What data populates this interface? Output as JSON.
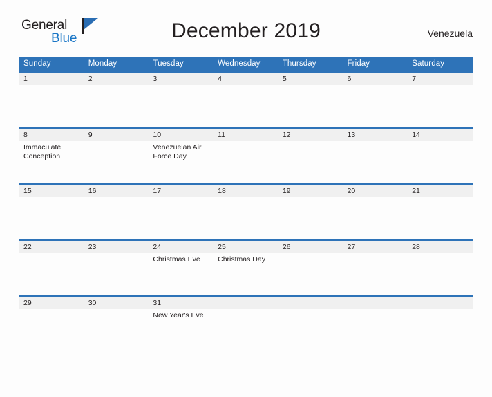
{
  "logo": {
    "word_one": "General",
    "word_two": "Blue",
    "flag_color": "#2a6db3",
    "blue_text_color": "#1a76c6",
    "dark_text_color": "#231f20"
  },
  "header": {
    "title": "December 2019",
    "region": "Venezuela"
  },
  "theme": {
    "header_blue": "#2e73b8",
    "row_rule_blue": "#2e73b8",
    "daynum_band": "#f0f0f0",
    "page_background": "#fdfdfd",
    "text": "#231f20"
  },
  "calendar": {
    "month": "December",
    "year": "2019",
    "weekday_headers": [
      "Sunday",
      "Monday",
      "Tuesday",
      "Wednesday",
      "Thursday",
      "Friday",
      "Saturday"
    ],
    "weeks": [
      [
        {
          "day": "1",
          "event": ""
        },
        {
          "day": "2",
          "event": ""
        },
        {
          "day": "3",
          "event": ""
        },
        {
          "day": "4",
          "event": ""
        },
        {
          "day": "5",
          "event": ""
        },
        {
          "day": "6",
          "event": ""
        },
        {
          "day": "7",
          "event": ""
        }
      ],
      [
        {
          "day": "8",
          "event": "Immaculate Conception"
        },
        {
          "day": "9",
          "event": ""
        },
        {
          "day": "10",
          "event": "Venezuelan Air Force Day"
        },
        {
          "day": "11",
          "event": ""
        },
        {
          "day": "12",
          "event": ""
        },
        {
          "day": "13",
          "event": ""
        },
        {
          "day": "14",
          "event": ""
        }
      ],
      [
        {
          "day": "15",
          "event": ""
        },
        {
          "day": "16",
          "event": ""
        },
        {
          "day": "17",
          "event": ""
        },
        {
          "day": "18",
          "event": ""
        },
        {
          "day": "19",
          "event": ""
        },
        {
          "day": "20",
          "event": ""
        },
        {
          "day": "21",
          "event": ""
        }
      ],
      [
        {
          "day": "22",
          "event": ""
        },
        {
          "day": "23",
          "event": ""
        },
        {
          "day": "24",
          "event": "Christmas Eve"
        },
        {
          "day": "25",
          "event": "Christmas Day"
        },
        {
          "day": "26",
          "event": ""
        },
        {
          "day": "27",
          "event": ""
        },
        {
          "day": "28",
          "event": ""
        }
      ],
      [
        {
          "day": "29",
          "event": ""
        },
        {
          "day": "30",
          "event": ""
        },
        {
          "day": "31",
          "event": "New Year's Eve"
        },
        {
          "day": "",
          "event": ""
        },
        {
          "day": "",
          "event": ""
        },
        {
          "day": "",
          "event": ""
        },
        {
          "day": "",
          "event": ""
        }
      ]
    ]
  }
}
